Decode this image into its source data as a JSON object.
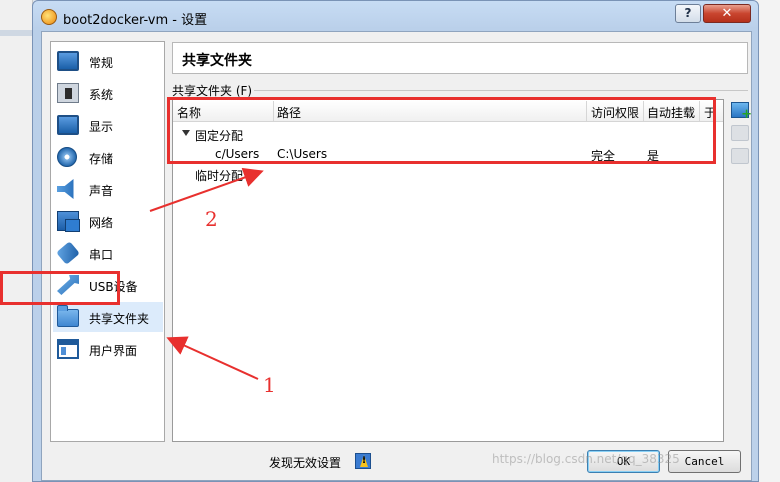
{
  "window": {
    "title": "boot2docker-vm - 设置",
    "help_label": "?",
    "close_label": "✕"
  },
  "nav": {
    "items": [
      {
        "label": "常规",
        "icon": "monitor-icon"
      },
      {
        "label": "系统",
        "icon": "chip-icon"
      },
      {
        "label": "显示",
        "icon": "display-icon"
      },
      {
        "label": "存储",
        "icon": "disk-icon"
      },
      {
        "label": "声音",
        "icon": "speaker-icon"
      },
      {
        "label": "网络",
        "icon": "network-icon"
      },
      {
        "label": "串口",
        "icon": "serial-port-icon"
      },
      {
        "label": "USB设备",
        "icon": "usb-icon"
      },
      {
        "label": "共享文件夹",
        "icon": "folder-icon"
      },
      {
        "label": "用户界面",
        "icon": "ui-icon"
      }
    ],
    "selected": "共享文件夹"
  },
  "main": {
    "page_title": "共享文件夹",
    "group_label": "共享文件夹 (F)",
    "table": {
      "columns": [
        "名称",
        "路径",
        "访问权限",
        "自动挂载",
        "于"
      ],
      "groups": [
        {
          "label": "固定分配",
          "rows": [
            {
              "name": "c/Users",
              "path": "C:\\Users",
              "access": "完全",
              "auto_mount": "是"
            }
          ]
        },
        {
          "label": "临时分配",
          "rows": []
        }
      ]
    }
  },
  "footer": {
    "warning_text": "发现无效设置",
    "ok_label": "OK",
    "cancel_label": "Cancel",
    "watermark": "https://blog.csdn.net/qq_38325"
  },
  "annotations": {
    "label_1": "1",
    "label_2": "2",
    "color": "#e8302e"
  }
}
